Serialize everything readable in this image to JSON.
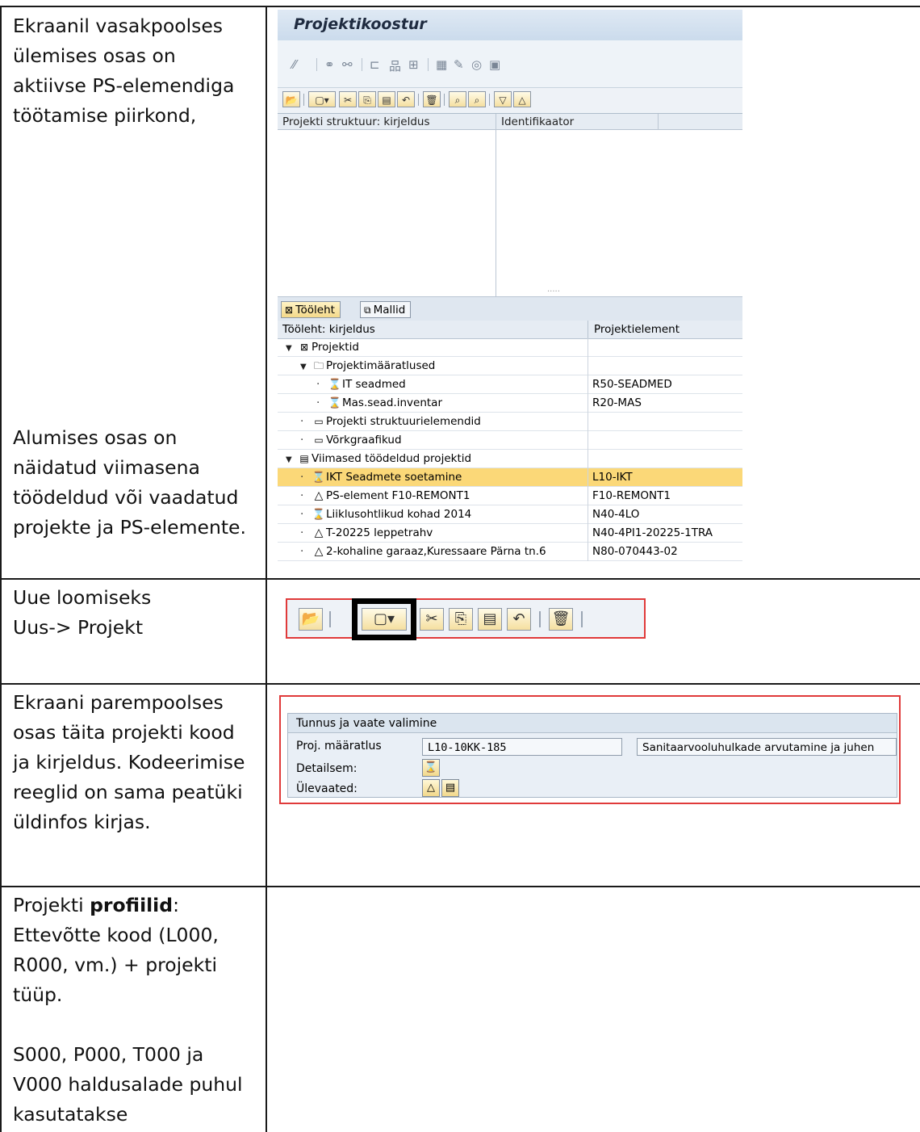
{
  "rows": [
    {
      "top_text": "Ekraanil vasakpoolses ülemises osas on aktiivse PS-elemendiga töötamise piirkond,",
      "bottom_text": "Alumises osas on näidatud viimasena töödeldud või vaadatud  projekte ja PS-elemente."
    },
    {
      "text": "Uue loomiseks\nUus-> Projekt"
    },
    {
      "text": "Ekraani parempoolses osas täita projekti kood ja kirjeldus. Kodeerimise reeglid on sama peatüki üldinfos kirjas."
    },
    {
      "text_before": "Projekti ",
      "text_bold": "profiilid",
      "text_after": ":\nEttevõtte kood (L000, R000, vm.) + projekti tüüp.",
      "text_2": "S000, P000, T000 ja V000 haldusalade puhul kasutatakse"
    }
  ],
  "sap_builder": {
    "title": "Projektikoostur",
    "structure_columns": [
      "Projekti struktuur: kirjeldus",
      "Identifikaator"
    ],
    "splitter": ".....",
    "tabs": {
      "worksheet": "Tööleht",
      "templates": "Mallid"
    },
    "worksheet_columns": [
      "Tööleht: kirjeldus",
      "Projektielement"
    ],
    "tree": [
      {
        "label": "Projektid",
        "value": ""
      },
      {
        "label": "Projektimääratlused",
        "value": ""
      },
      {
        "label": "IT seadmed",
        "value": "R50-SEADMED"
      },
      {
        "label": "Mas.sead.inventar",
        "value": "R20-MAS"
      },
      {
        "label": "Projekti struktuurielemendid",
        "value": ""
      },
      {
        "label": "Võrkgraafikud",
        "value": ""
      },
      {
        "label": "Viimased töödeldud projektid",
        "value": ""
      },
      {
        "label": "IKT Seadmete soetamine",
        "value": "L10-IKT"
      },
      {
        "label": "PS-element F10-REMONT1",
        "value": "F10-REMONT1"
      },
      {
        "label": "Liiklusohtlikud kohad 2014",
        "value": "N40-4LO"
      },
      {
        "label": "T-20225 leppetrahv",
        "value": "N40-4PI1-20225-1TRA"
      },
      {
        "label": "2-kohaline garaaz,Kuressaare Pärna tn.6",
        "value": "N80-070443-02"
      }
    ]
  },
  "sap_form": {
    "header": "Tunnus ja vaate valimine",
    "proj_label": "Proj. määratlus",
    "proj_code": "L10-10KK-185",
    "proj_desc": "Sanitaarvooluhulkade arvutamine ja juhen",
    "detail_label": "Detailsem:",
    "overview_label": "Ülevaated:"
  },
  "colors": {
    "highlight": "#fbd878",
    "red_frame": "#e03a3a"
  }
}
